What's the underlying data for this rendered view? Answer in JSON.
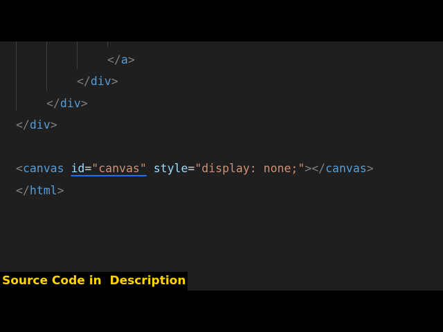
{
  "editor": {
    "lines": {
      "close_a": {
        "open": "</",
        "tag": "a",
        "close": ">"
      },
      "close_div_inner": {
        "open": "</",
        "tag": "div",
        "close": ">"
      },
      "close_div_mid": {
        "open": "</",
        "tag": "div",
        "close": ">"
      },
      "close_div_outer": {
        "open": "</",
        "tag": "div",
        "close": ">"
      },
      "canvas": {
        "open": "<",
        "tag": "canvas",
        "attr1_name": "id",
        "eq1": "=",
        "attr1_value": "\"canvas\"",
        "attr2_name": "style",
        "eq2": "=",
        "attr2_value": "\"display: none;\"",
        "mid": "></",
        "close_tag": "canvas",
        "close": ">"
      },
      "close_html": {
        "open": "</",
        "tag": "html",
        "close": ">"
      }
    }
  },
  "caption": {
    "text": "Source Code in  Description",
    "color": "#ffd400"
  },
  "colors": {
    "editor_background": "#1f1f1f",
    "tag": "#569cd6",
    "punctuation": "#808080",
    "attribute": "#9cdcfe",
    "string": "#ce9178",
    "error_squiggle": "#1f6fff"
  }
}
